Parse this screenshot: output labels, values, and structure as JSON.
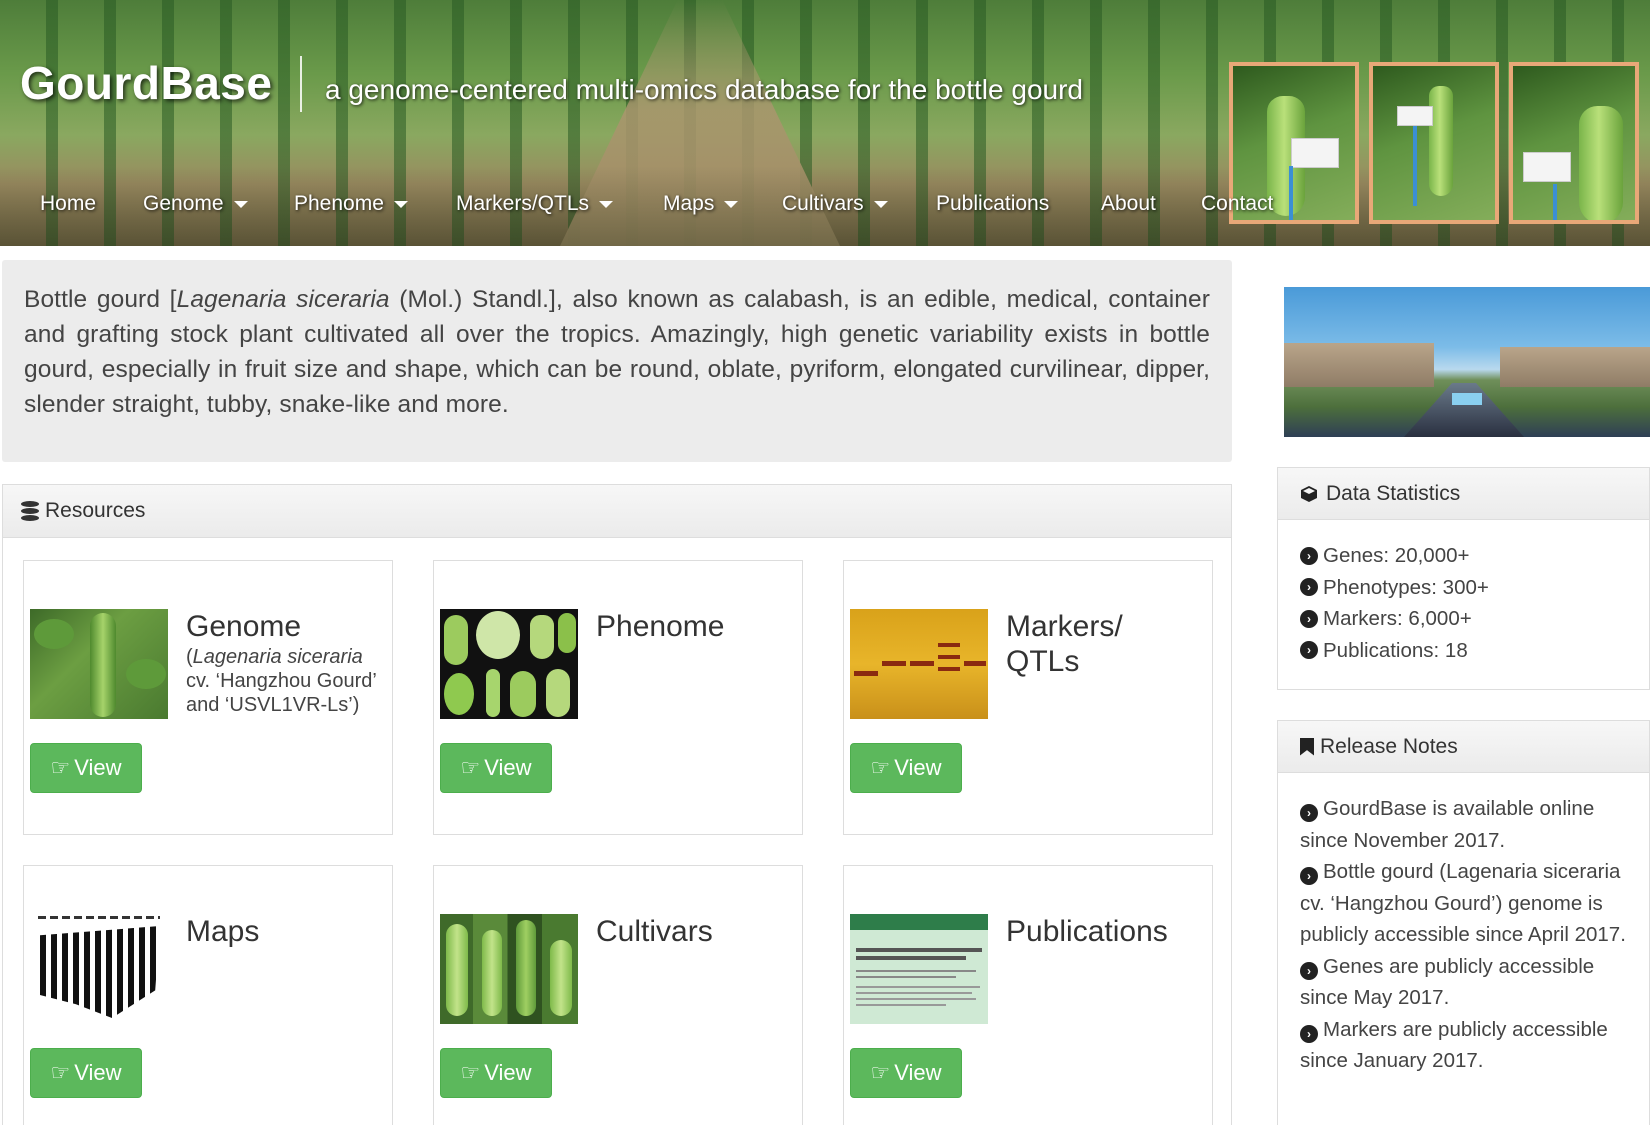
{
  "header": {
    "brand": "GourdBase",
    "tagline": "a genome-centered multi-omics database for the bottle gourd"
  },
  "nav": [
    {
      "label": "Home",
      "dropdown": false
    },
    {
      "label": "Genome",
      "dropdown": true
    },
    {
      "label": "Phenome",
      "dropdown": true
    },
    {
      "label": "Markers/QTLs",
      "dropdown": true
    },
    {
      "label": "Maps",
      "dropdown": true
    },
    {
      "label": "Cultivars",
      "dropdown": true
    },
    {
      "label": "Publications",
      "dropdown": false
    },
    {
      "label": "About",
      "dropdown": false
    },
    {
      "label": "Contact",
      "dropdown": false
    }
  ],
  "intro": {
    "part1": "Bottle gourd [",
    "species": "Lagenaria siceraria",
    "part2": " (Mol.) Standl.], also known as calabash, is an edible, medical, container and grafting stock plant cultivated all over the tropics. Amazingly, high genetic variability exists in bottle gourd, especially in fruit size and shape, which can be round, oblate, pyriform, elongated curvilinear, dipper, slender straight, tubby, snake-like and more."
  },
  "resources": {
    "heading": "Resources",
    "view_label": "View",
    "genome": {
      "title": "Genome",
      "sub_open": "(",
      "sub_italic": "Lagenaria siceraria",
      "sub_rest": " cv. ‘Hangzhou Gourd’ and ‘USVL1VR-Ls’)"
    },
    "phenome": {
      "title": "Phenome"
    },
    "markers": {
      "title_line1": "Markers/",
      "title_line2": "QTLs"
    },
    "maps": {
      "title": "Maps"
    },
    "cultivars": {
      "title": "Cultivars"
    },
    "publications": {
      "title": "Publications"
    }
  },
  "stats": {
    "heading": "Data Statistics",
    "items": [
      "Genes: 20,000+",
      "Phenotypes: 300+",
      "Markers: 6,000+",
      "Publications: 18"
    ]
  },
  "release": {
    "heading": "Release Notes",
    "items": [
      "GourdBase is available online since November 2017.",
      "Bottle gourd (Lagenaria siceraria cv. ‘Hangzhou Gourd’) genome is publicly accessible since April 2017.",
      "Genes are publicly accessible since May 2017.",
      "Markers are publicly accessible since January 2017."
    ]
  },
  "colors": {
    "view_button": "#5cb85c",
    "panel_header": "#ebebeb",
    "intro_background": "#ececec",
    "photo_frame": "#e8a878"
  }
}
